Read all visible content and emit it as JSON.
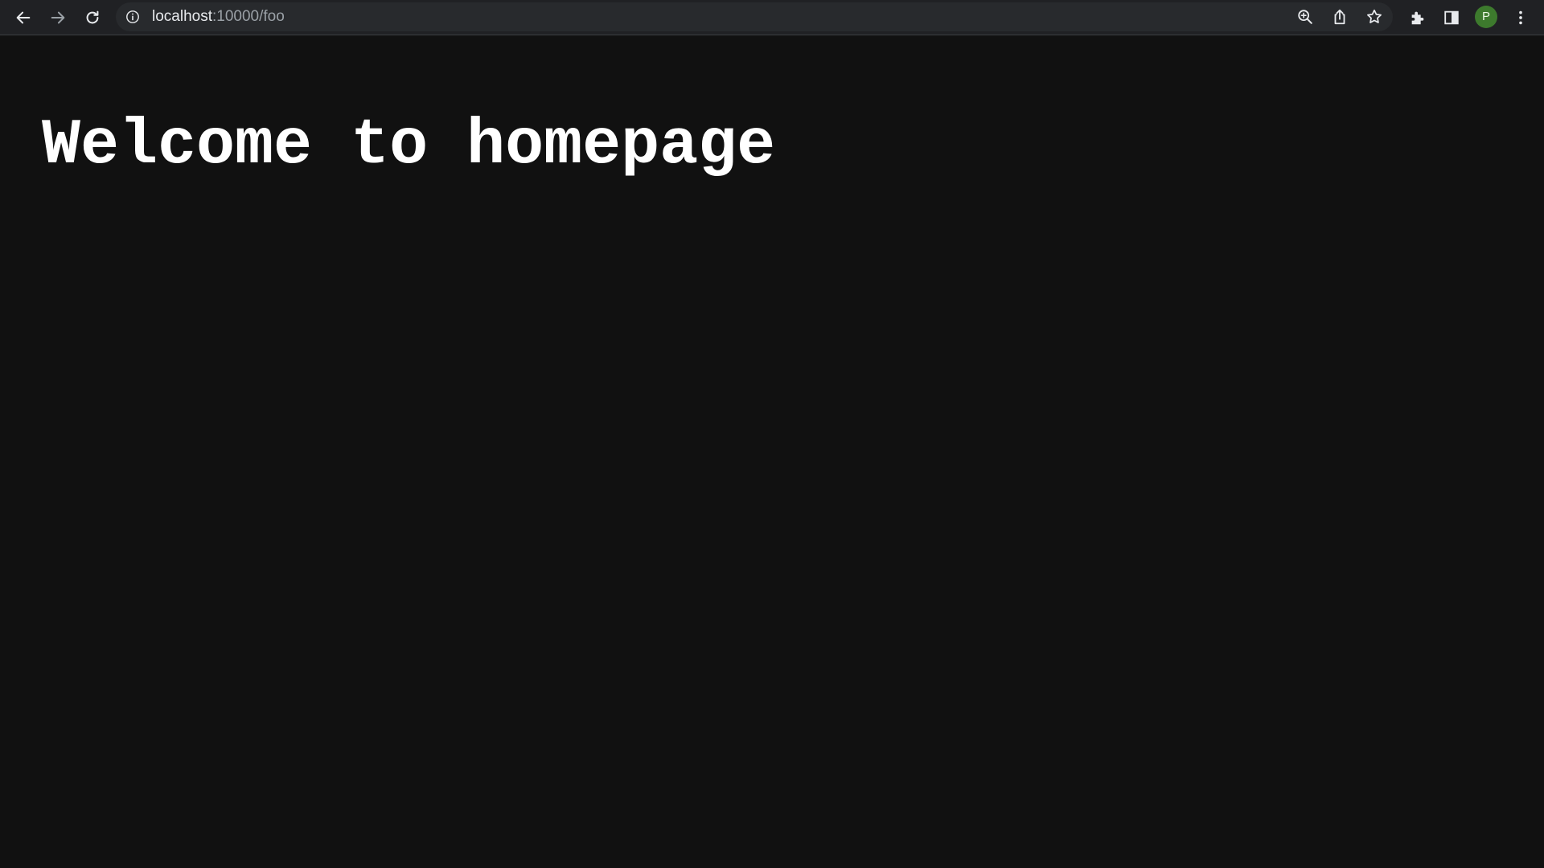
{
  "browser": {
    "address_bar": {
      "host": "localhost",
      "rest": ":10000/foo"
    },
    "profile_initial": "P",
    "icons": {
      "back": "back-arrow-icon",
      "forward": "forward-arrow-icon",
      "reload": "reload-icon",
      "site_info": "info-icon",
      "zoom": "zoom-icon",
      "share": "share-icon",
      "bookmark": "star-icon",
      "extensions": "puzzle-icon",
      "side_panel": "side-panel-icon",
      "menu": "kebab-menu-icon"
    },
    "colors": {
      "toolbar": "#202124",
      "omnibox": "#282a2d",
      "avatar": "#3d7a2d"
    }
  },
  "page": {
    "heading": "Welcome to homepage",
    "colors": {
      "background": "#111111",
      "text": "#ffffff"
    }
  }
}
